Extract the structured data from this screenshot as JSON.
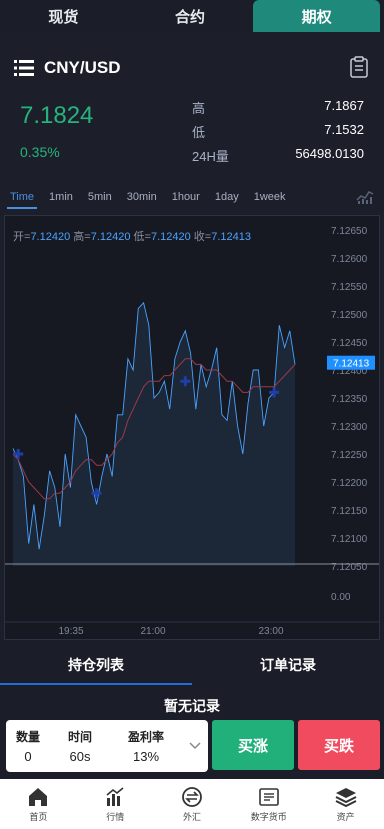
{
  "top_tabs": [
    "现货",
    "合约",
    "期权"
  ],
  "pair": "CNY/USD",
  "price": "7.1824",
  "change": "0.35%",
  "stats": {
    "high_label": "高",
    "high_value": "7.1867",
    "low_label": "低",
    "low_value": "7.1532",
    "vol_label": "24H量",
    "vol_value": "56498.0130"
  },
  "periods": [
    "Time",
    "1min",
    "5min",
    "30min",
    "1hour",
    "1day",
    "1week"
  ],
  "ohlc": {
    "open_label": "开=",
    "open": "7.12420",
    "high_label": "高=",
    "high": "7.12420",
    "low_label": "低=",
    "low": "7.12420",
    "close_label": "收=",
    "close": "7.12413"
  },
  "chart_data": {
    "type": "line",
    "y_ticks": [
      "7.12650",
      "7.12600",
      "7.12550",
      "7.12500",
      "7.12450",
      "7.12400",
      "7.12350",
      "7.12300",
      "7.12250",
      "7.12200",
      "7.12150",
      "7.12100",
      "7.12050"
    ],
    "ylim": [
      7.1205,
      7.1265
    ],
    "current_price_tag": "7.12413",
    "volume_tick": "0.00",
    "x_ticks": [
      "19:35",
      "21:00",
      "23:00"
    ],
    "colors": {
      "line": "#4aa3ff",
      "ma": "#9a3a4a",
      "marker": "#1f3ea8"
    },
    "series": [
      {
        "values": [
          7.1226,
          7.1224,
          7.1221,
          7.1209,
          7.1216,
          7.1208,
          7.1214,
          7.1222,
          7.1219,
          7.1212,
          7.1225,
          7.1219,
          7.1232,
          7.123,
          7.1228,
          7.122,
          7.1216,
          7.1221,
          7.1225,
          7.1221,
          7.1232,
          7.1232,
          7.1242,
          7.124,
          7.1251,
          7.1252,
          7.1248,
          7.1235,
          7.1236,
          7.1238,
          7.1233,
          7.1242,
          7.1245,
          7.1247,
          7.1243,
          7.1233,
          7.1241,
          7.1237,
          7.124,
          7.1244,
          7.1232,
          7.1231,
          7.1238,
          7.123,
          7.1225,
          7.1234,
          7.124,
          7.124,
          7.123,
          7.1235,
          7.1236,
          7.1248,
          7.1244,
          7.1247,
          7.1241
        ]
      },
      {
        "values": [
          7.1225,
          7.1224,
          7.1222,
          7.122,
          7.1219,
          7.1218,
          7.1217,
          7.1217,
          7.1218,
          7.1218,
          7.1219,
          7.122,
          7.1222,
          7.1223,
          7.1224,
          7.1224,
          7.1223,
          7.1223,
          7.1224,
          7.1225,
          7.1227,
          7.1228,
          7.1231,
          7.1233,
          7.1235,
          7.1237,
          7.1238,
          7.1238,
          7.1238,
          7.1239,
          7.1239,
          7.124,
          7.1241,
          7.1242,
          7.1242,
          7.1241,
          7.1241,
          7.124,
          7.124,
          7.124,
          7.1239,
          7.1238,
          7.1238,
          7.1237,
          7.1236,
          7.1236,
          7.1237,
          7.1237,
          7.1237,
          7.1237,
          7.1237,
          7.1238,
          7.1239,
          7.124,
          7.1241
        ]
      }
    ],
    "markers": [
      7.1225,
      7.1218,
      7.1238,
      7.1236
    ]
  },
  "list_tabs": [
    "持仓列表",
    "订单记录"
  ],
  "empty_message": "暂无记录",
  "trade": {
    "qty_label": "数量",
    "qty_value": "0",
    "time_label": "时间",
    "time_value": "60s",
    "rate_label": "盈利率",
    "rate_value": "13%"
  },
  "buy_label": "买涨",
  "sell_label": "买跌",
  "nav": [
    "首页",
    "行情",
    "外汇",
    "数字货币",
    "资产"
  ]
}
